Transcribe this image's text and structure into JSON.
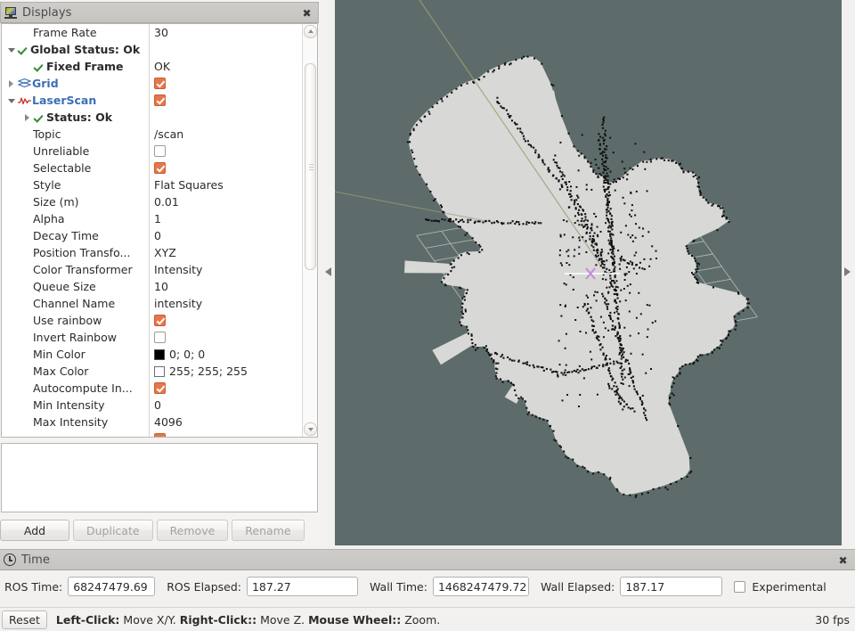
{
  "displays_panel": {
    "title": "Displays",
    "icon": "monitor-icon",
    "close_label": "✖",
    "tree": [
      {
        "indent": 1,
        "twist": "none",
        "status": "none",
        "icon": "none",
        "label": "Frame Rate",
        "value_type": "text",
        "value": "30"
      },
      {
        "indent": 0,
        "twist": "open",
        "status": "ok",
        "icon": "none",
        "label": "Global Status: Ok",
        "bold": true,
        "value_type": "none",
        "value": ""
      },
      {
        "indent": 1,
        "twist": "none",
        "status": "ok",
        "icon": "none",
        "label": "Fixed Frame",
        "bold": true,
        "value_type": "text",
        "value": "OK"
      },
      {
        "indent": 0,
        "twist": "closed",
        "status": "none",
        "icon": "grid-icon",
        "label": "Grid",
        "category": true,
        "value_type": "checkbox",
        "value": "checked"
      },
      {
        "indent": 0,
        "twist": "open",
        "status": "none",
        "icon": "laserscan-icon",
        "label": "LaserScan",
        "category": true,
        "value_type": "checkbox",
        "value": "checked"
      },
      {
        "indent": 1,
        "twist": "closed",
        "status": "ok",
        "icon": "none",
        "label": "Status: Ok",
        "bold": true,
        "value_type": "none",
        "value": ""
      },
      {
        "indent": 1,
        "twist": "none",
        "status": "none",
        "icon": "none",
        "label": "Topic",
        "value_type": "text",
        "value": "/scan"
      },
      {
        "indent": 1,
        "twist": "none",
        "status": "none",
        "icon": "none",
        "label": "Unreliable",
        "value_type": "checkbox",
        "value": "unchecked"
      },
      {
        "indent": 1,
        "twist": "none",
        "status": "none",
        "icon": "none",
        "label": "Selectable",
        "value_type": "checkbox",
        "value": "checked"
      },
      {
        "indent": 1,
        "twist": "none",
        "status": "none",
        "icon": "none",
        "label": "Style",
        "value_type": "text",
        "value": "Flat Squares"
      },
      {
        "indent": 1,
        "twist": "none",
        "status": "none",
        "icon": "none",
        "label": "Size (m)",
        "value_type": "text",
        "value": "0.01"
      },
      {
        "indent": 1,
        "twist": "none",
        "status": "none",
        "icon": "none",
        "label": "Alpha",
        "value_type": "text",
        "value": "1"
      },
      {
        "indent": 1,
        "twist": "none",
        "status": "none",
        "icon": "none",
        "label": "Decay Time",
        "value_type": "text",
        "value": "0"
      },
      {
        "indent": 1,
        "twist": "none",
        "status": "none",
        "icon": "none",
        "label": "Position Transfo...",
        "value_type": "text",
        "value": "XYZ"
      },
      {
        "indent": 1,
        "twist": "none",
        "status": "none",
        "icon": "none",
        "label": "Color Transformer",
        "value_type": "text",
        "value": "Intensity"
      },
      {
        "indent": 1,
        "twist": "none",
        "status": "none",
        "icon": "none",
        "label": "Queue Size",
        "value_type": "text",
        "value": "10"
      },
      {
        "indent": 1,
        "twist": "none",
        "status": "none",
        "icon": "none",
        "label": "Channel Name",
        "value_type": "text",
        "value": "intensity"
      },
      {
        "indent": 1,
        "twist": "none",
        "status": "none",
        "icon": "none",
        "label": "Use rainbow",
        "value_type": "checkbox",
        "value": "checked"
      },
      {
        "indent": 1,
        "twist": "none",
        "status": "none",
        "icon": "none",
        "label": "Invert Rainbow",
        "value_type": "checkbox",
        "value": "unchecked"
      },
      {
        "indent": 1,
        "twist": "none",
        "status": "none",
        "icon": "none",
        "label": "Min Color",
        "value_type": "color",
        "swatch": "black",
        "value": "0; 0; 0"
      },
      {
        "indent": 1,
        "twist": "none",
        "status": "none",
        "icon": "none",
        "label": "Max Color",
        "value_type": "color",
        "swatch": "white",
        "value": "255; 255; 255"
      },
      {
        "indent": 1,
        "twist": "none",
        "status": "none",
        "icon": "none",
        "label": "Autocompute In...",
        "value_type": "checkbox",
        "value": "checked"
      },
      {
        "indent": 1,
        "twist": "none",
        "status": "none",
        "icon": "none",
        "label": "Min Intensity",
        "value_type": "text",
        "value": "0"
      },
      {
        "indent": 1,
        "twist": "none",
        "status": "none",
        "icon": "none",
        "label": "Max Intensity",
        "value_type": "text",
        "value": "4096"
      }
    ],
    "buttons": [
      {
        "label": "Add",
        "enabled": true
      },
      {
        "label": "Duplicate",
        "enabled": false
      },
      {
        "label": "Remove",
        "enabled": false
      },
      {
        "label": "Rename",
        "enabled": false
      }
    ]
  },
  "render_view": {
    "background_color": "#5d6c6a",
    "grid_color": "#b9c2c0",
    "cloud_fill": "#d8d8d6",
    "point_color": "#111111",
    "axis_marker_color": "#c8a0e0"
  },
  "time_panel": {
    "title": "Time",
    "icon": "clock-icon",
    "close_label": "✖",
    "fields": [
      {
        "label": "ROS Time:",
        "value": "68247479.69"
      },
      {
        "label": "ROS Elapsed:",
        "value": "187.27"
      },
      {
        "label": "Wall Time:",
        "value": "1468247479.72"
      },
      {
        "label": "Wall Elapsed:",
        "value": "187.17"
      }
    ],
    "experimental": {
      "label": "Experimental",
      "checked": false
    }
  },
  "status_bar": {
    "reset_label": "Reset",
    "help": {
      "left_click_key": "Left-Click:",
      "left_click_action": " Move X/Y. ",
      "right_click_key": "Right-Click::",
      "right_click_action": " Move Z. ",
      "wheel_key": "Mouse Wheel::",
      "wheel_action": " Zoom."
    },
    "fps": "30 fps"
  }
}
